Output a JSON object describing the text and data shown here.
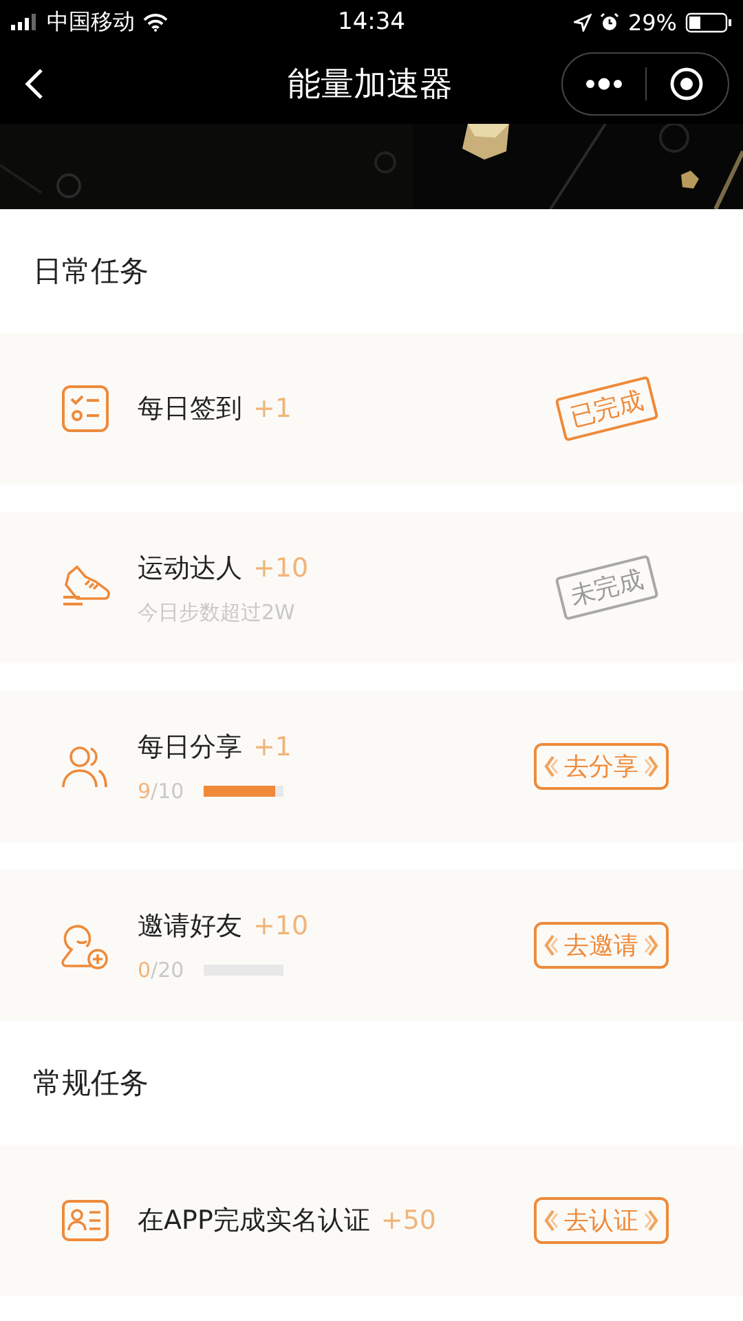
{
  "status_bar": {
    "carrier": "中国移动",
    "time": "14:34",
    "battery": "29%"
  },
  "nav": {
    "title": "能量加速器"
  },
  "sections": [
    {
      "title": "日常任务",
      "tasks": [
        {
          "kind": "checklist",
          "name": "每日签到",
          "points": "+1",
          "action": {
            "kind": "stamp",
            "label": "已完成",
            "completed": true
          }
        },
        {
          "kind": "shoe",
          "name": "运动达人",
          "points": "+10",
          "note": "今日步数超过2W",
          "action": {
            "kind": "stamp",
            "label": "未完成",
            "completed": false
          }
        },
        {
          "kind": "people",
          "name": "每日分享",
          "points": "+1",
          "progress": {
            "done": "9",
            "total": "/10",
            "level": 0.9
          },
          "action": {
            "kind": "button",
            "label": "去分享"
          }
        },
        {
          "kind": "add-user",
          "name": "邀请好友",
          "points": "+10",
          "progress": {
            "done": "0",
            "total": "/20",
            "level": 0
          },
          "action": {
            "kind": "button",
            "label": "去邀请"
          }
        }
      ]
    },
    {
      "title": "常规任务",
      "tasks": [
        {
          "kind": "id-card",
          "name": "在APP完成实名认证",
          "points": "+50",
          "action": {
            "kind": "button",
            "label": "去认证"
          }
        }
      ]
    }
  ]
}
